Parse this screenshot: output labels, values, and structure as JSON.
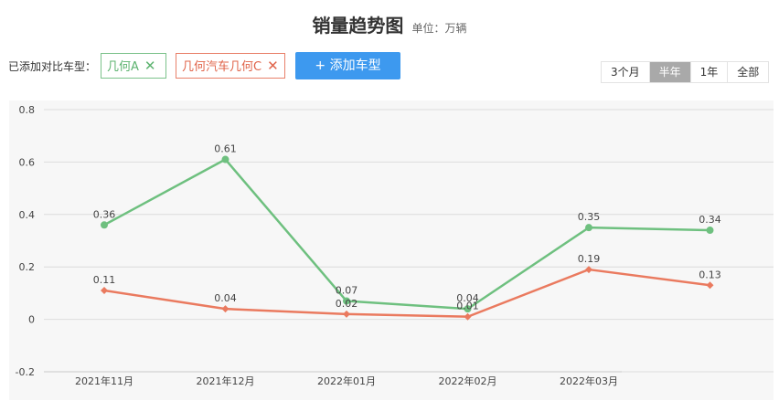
{
  "header": {
    "title": "销量趋势图",
    "unit": "单位：万辆"
  },
  "compare": {
    "label": "已添加对比车型：",
    "tags": [
      {
        "label": "几何A",
        "remove": "✕",
        "color": "#5cb36f"
      },
      {
        "label": "几何汽车几何C",
        "remove": "✕",
        "color": "#e0644a"
      }
    ],
    "add_label": "+ 添加车型"
  },
  "range": {
    "options": [
      "3个月",
      "半年",
      "1年",
      "全部"
    ],
    "active": "半年"
  },
  "chart_data": {
    "type": "line",
    "categories": [
      "2021年11月",
      "2021年12月",
      "2022年01月",
      "2022年02月",
      "2022年03月",
      ""
    ],
    "series": [
      {
        "values": [
          0.36,
          0.61,
          0.07,
          0.04,
          0.35,
          0.34
        ],
        "color": "#6ec07f",
        "marker": "circle"
      },
      {
        "values": [
          0.11,
          0.04,
          0.02,
          0.01,
          0.19,
          0.13
        ],
        "color": "#ea7a5f",
        "marker": "diamond"
      }
    ],
    "yticks": [
      "0.8",
      "0.6",
      "0.4",
      "0.2",
      "0",
      "-0.2"
    ],
    "ylim": [
      -0.2,
      0.8
    ],
    "grid": true
  }
}
